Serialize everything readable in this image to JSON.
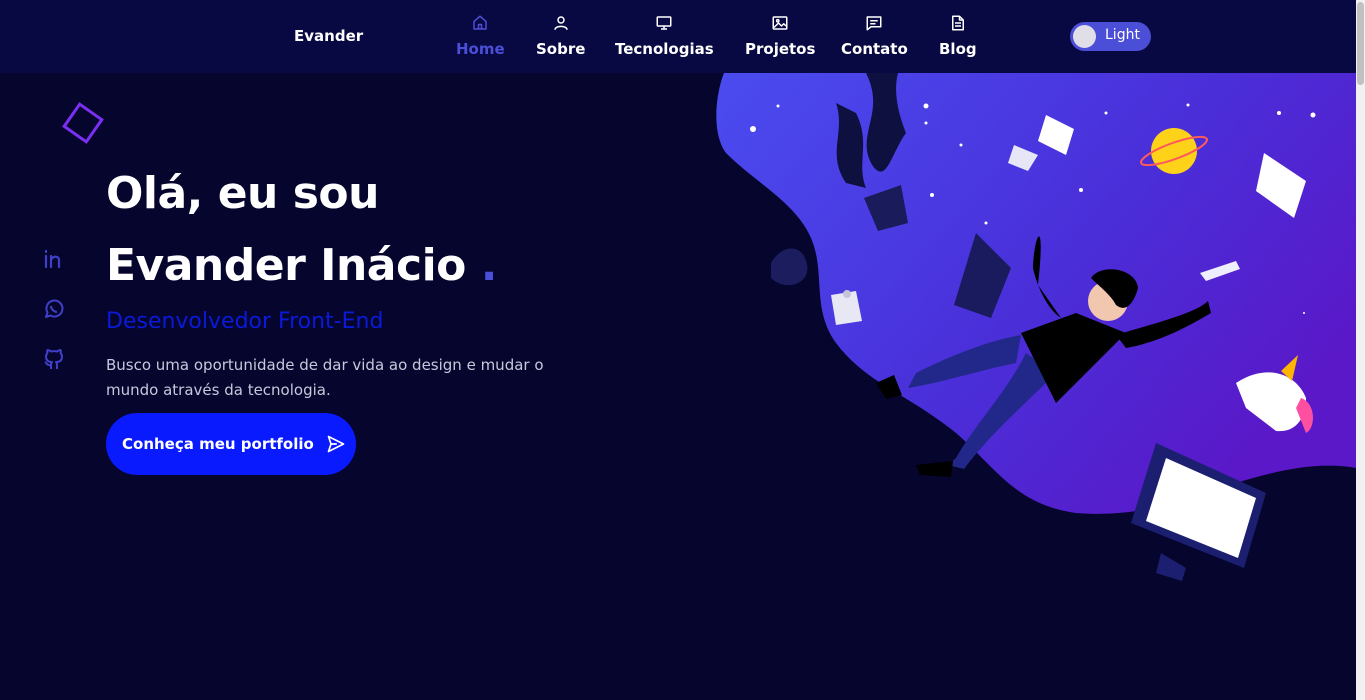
{
  "nav": {
    "brand": "Evander",
    "items": [
      {
        "label": "Home",
        "icon": "home-icon",
        "active": true
      },
      {
        "label": "Sobre",
        "icon": "user-icon"
      },
      {
        "label": "Tecnologias",
        "icon": "monitor-icon"
      },
      {
        "label": "Projetos",
        "icon": "image-icon"
      },
      {
        "label": "Contato",
        "icon": "message-icon"
      },
      {
        "label": "Blog",
        "icon": "document-icon"
      }
    ],
    "theme_toggle": "Light"
  },
  "hero": {
    "greeting": "Olá, eu sou",
    "name": "Evander Inácio",
    "dot": ".",
    "role": "Desenvolvedor Front-End",
    "description": "Busco uma oportunidade de dar vida ao design e mudar o mundo através da tecnologia.",
    "cta_label": "Conheça meu portfolio"
  },
  "social": [
    "linkedin-icon",
    "whatsapp-icon",
    "github-icon"
  ],
  "colors": {
    "background": "#05052e",
    "navbar": "#080842",
    "accent": "#4b4ed6",
    "cta": "#0a1aff",
    "role_text": "#0a1ad8",
    "decoration": "#7b2ff0"
  }
}
